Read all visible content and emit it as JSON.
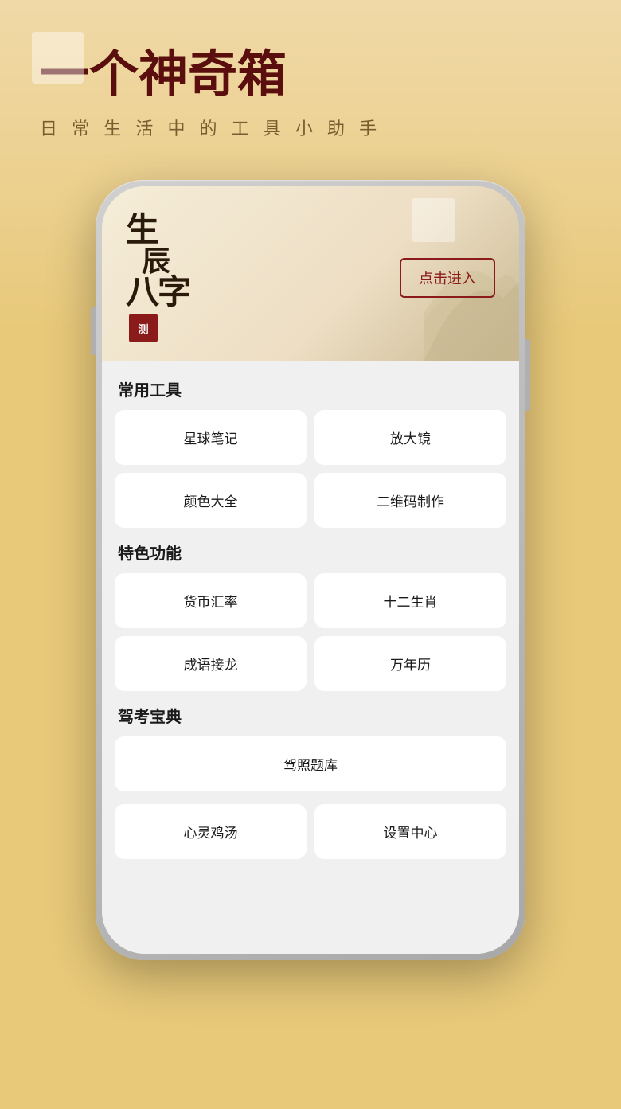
{
  "hero": {
    "title": "一个神奇箱",
    "subtitle": "日 常 生 活 中 的 工 具 小 助 手"
  },
  "phone": {
    "header": {
      "calligraphy": {
        "line1": "生",
        "line2": "辰",
        "line3": "八字",
        "seal": "测"
      },
      "enter_button": "点击进入"
    },
    "sections": [
      {
        "title": "常用工具",
        "items": [
          {
            "label": "星球笔记"
          },
          {
            "label": "放大镜"
          },
          {
            "label": "颜色大全"
          },
          {
            "label": "二维码制作"
          }
        ]
      },
      {
        "title": "特色功能",
        "items": [
          {
            "label": "货币汇率"
          },
          {
            "label": "十二生肖"
          },
          {
            "label": "成语接龙"
          },
          {
            "label": "万年历"
          }
        ]
      },
      {
        "title": "驾考宝典",
        "items": [
          {
            "label": "驾照题库"
          }
        ]
      }
    ],
    "bottom_items": [
      {
        "label": "心灵鸡汤"
      },
      {
        "label": "设置中心"
      }
    ]
  },
  "colors": {
    "background": "#e8c97a",
    "hero_title": "#5a0e0e",
    "hero_subtitle": "#7a5c30",
    "seal_bg": "#8b1a1a",
    "enter_button_border": "#8b1a1a"
  }
}
